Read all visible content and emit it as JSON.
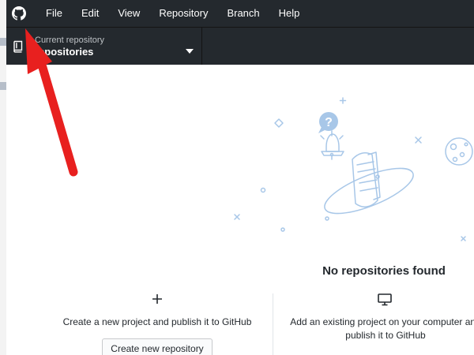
{
  "menubar": {
    "logo_icon": "github-octocat-icon",
    "items": [
      "File",
      "Edit",
      "View",
      "Repository",
      "Branch",
      "Help"
    ]
  },
  "toolbar": {
    "current_repository": {
      "label": "Current repository",
      "value": "repositories",
      "icon": "repo-book-icon"
    }
  },
  "main": {
    "empty_title": "No repositories found",
    "create_card": {
      "icon": "plus-icon",
      "description": "Create a new project and publish it to GitHub",
      "button_label": "Create new repository"
    },
    "add_card": {
      "icon": "monitor-icon",
      "description": "Add an existing project on your computer and publish it to GitHub"
    }
  },
  "annotation": {
    "type": "red-arrow-pointing-to-github-logo",
    "color": "#e8201f"
  },
  "colors": {
    "menubar_bg": "#24292e",
    "illustration_accent": "#a8c7e8"
  }
}
